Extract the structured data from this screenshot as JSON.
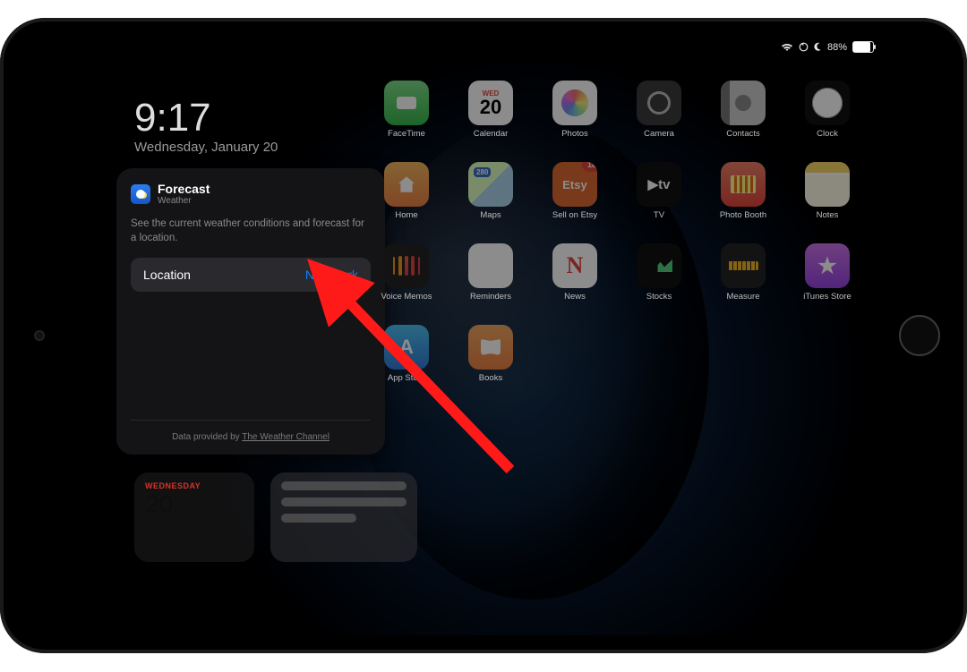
{
  "status": {
    "battery_pct": "88%"
  },
  "clock": {
    "time": "9:17",
    "date": "Wednesday, January 20"
  },
  "widget": {
    "title": "Forecast",
    "subtitle": "Weather",
    "description": "See the current weather conditions and forecast for a location.",
    "location_label": "Location",
    "location_value": "New York",
    "credit_prefix": "Data provided by ",
    "credit_link": "The Weather Channel"
  },
  "peek": {
    "cal_dow": "WEDNESDAY",
    "cal_day": "20"
  },
  "apps": {
    "row1": [
      {
        "name": "FaceTime",
        "cls": "ic-facetime"
      },
      {
        "name": "Calendar",
        "cls": "ic-calendar",
        "cal_dw": "WED",
        "cal_dy": "20"
      },
      {
        "name": "Photos",
        "cls": "ic-photos"
      },
      {
        "name": "Camera",
        "cls": "ic-camera"
      },
      {
        "name": "Contacts",
        "cls": "ic-contacts"
      },
      {
        "name": "Clock",
        "cls": "ic-clock"
      }
    ],
    "row2": [
      {
        "name": "Home",
        "cls": "ic-home"
      },
      {
        "name": "Maps",
        "cls": "ic-maps"
      },
      {
        "name": "Sell on Etsy",
        "cls": "ic-etsy",
        "txt": "Etsy",
        "badge": "18"
      },
      {
        "name": "TV",
        "cls": "ic-tv",
        "txt": "▶tv"
      },
      {
        "name": "Photo Booth",
        "cls": "ic-pb"
      },
      {
        "name": "Notes",
        "cls": "ic-notes"
      }
    ],
    "row3": [
      {
        "name": "Voice Memos",
        "cls": "ic-vm"
      },
      {
        "name": "Reminders",
        "cls": "ic-rem"
      },
      {
        "name": "News",
        "cls": "ic-news"
      },
      {
        "name": "Stocks",
        "cls": "ic-stocks"
      },
      {
        "name": "Measure",
        "cls": "ic-measure"
      },
      {
        "name": "iTunes Store",
        "cls": "ic-itunes"
      }
    ],
    "row4": [
      {
        "name": "App Store",
        "cls": "ic-appstore"
      },
      {
        "name": "Books",
        "cls": "ic-books"
      }
    ]
  }
}
